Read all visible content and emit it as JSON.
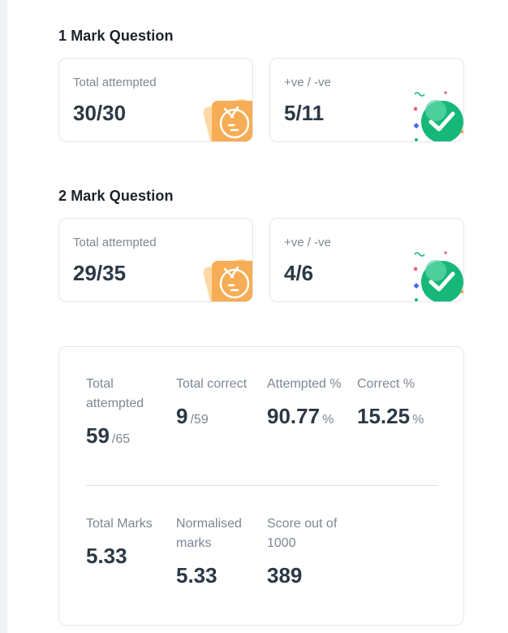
{
  "one_mark": {
    "title": "1 Mark Question",
    "attempted_label": "Total attempted",
    "attempted_value": "30/30",
    "ratio_label": "+ve / -ve",
    "ratio_value": "5/11"
  },
  "two_mark": {
    "title": "2 Mark Question",
    "attempted_label": "Total attempted",
    "attempted_value": "29/35",
    "ratio_label": "+ve / -ve",
    "ratio_value": "4/6"
  },
  "summary": {
    "total_attempted": {
      "label": "Total attempted",
      "value": "59",
      "sub": "/65"
    },
    "total_correct": {
      "label": "Total correct",
      "value": "9",
      "sub": "/59"
    },
    "attempted_pct": {
      "label": "Attempted %",
      "value": "90.77",
      "sub": "%"
    },
    "correct_pct": {
      "label": "Correct %",
      "value": "15.25",
      "sub": "%"
    },
    "total_marks": {
      "label": "Total Marks",
      "value": "5.33"
    },
    "normalised_marks": {
      "label": "Normalised marks",
      "value": "5.33"
    },
    "score_1000": {
      "label": "Score out of 1000",
      "value": "389"
    }
  },
  "icons": {
    "attempted": "notebook-icon",
    "ratio": "check-badge-icon"
  },
  "colors": {
    "orange": "#f6ad55",
    "green": "#16b87a",
    "text_dark": "#2c3845",
    "text_muted": "#7d8792"
  }
}
